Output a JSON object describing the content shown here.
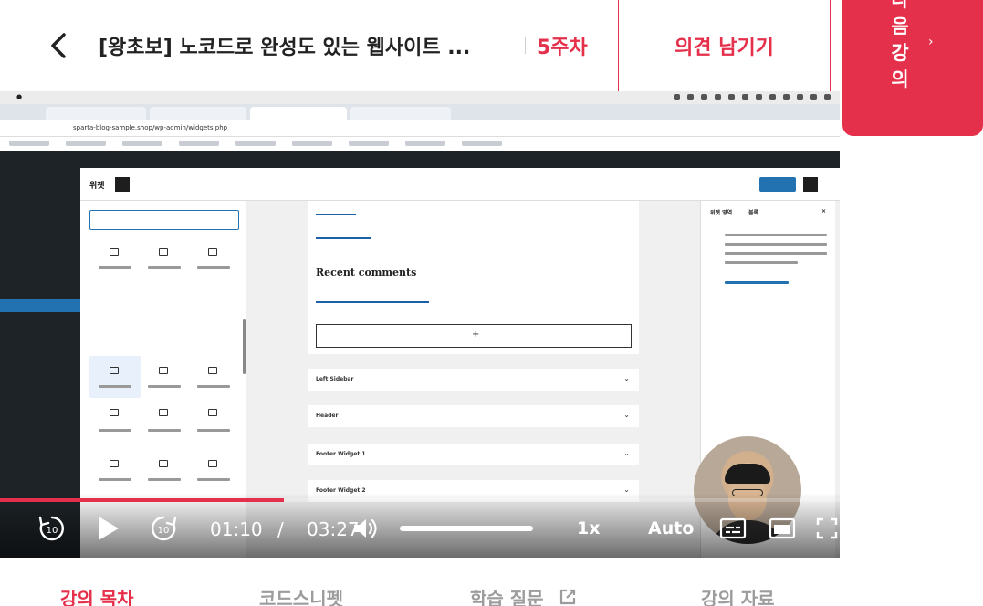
{
  "header": {
    "back_icon": "chevron-left-icon",
    "title": "[왕초보] 노코드로 완성도 있는 웹사이트 ...",
    "week": "5주차",
    "feedback": "의견 남기기",
    "next_lecture_chars": [
      "다",
      "음",
      "강",
      "의"
    ],
    "next_lecture_chevron": "›",
    "accent_color": "#e5304b"
  },
  "video": {
    "current_time": "01:10",
    "separator": "/",
    "duration": "03:27",
    "progress_fraction": 0.338,
    "volume_fraction": 1.0,
    "speed": "1x",
    "quality": "Auto",
    "controls": {
      "rewind_icon": "rewind-10-icon",
      "play_icon": "play-icon",
      "forward_icon": "forward-10-icon",
      "skip_seconds": "10",
      "volume_icon": "volume-icon",
      "subtitle_icon": "subtitles-icon",
      "pip_icon": "picture-in-picture-icon",
      "fullscreen_icon": "fullscreen-icon"
    },
    "screen": {
      "url": "sparta-blog-sample.shop/wp-admin/widgets.php",
      "widget_title": "위젯",
      "recent_comments": "Recent comments",
      "plus": "+",
      "accordion": [
        "Left Sidebar",
        "Header",
        "Footer Widget 1",
        "Footer Widget 2"
      ],
      "chevron": "⌄",
      "settings_tabs": [
        "위젯 영역",
        "블록"
      ],
      "settings_close": "×"
    }
  },
  "tabs": [
    {
      "label": "강의 목차",
      "active": true
    },
    {
      "label": "코드스니펫",
      "active": false
    },
    {
      "label": "학습 질문",
      "active": false,
      "icon": "external-link-icon"
    },
    {
      "label": "강의 자료",
      "active": false
    }
  ]
}
